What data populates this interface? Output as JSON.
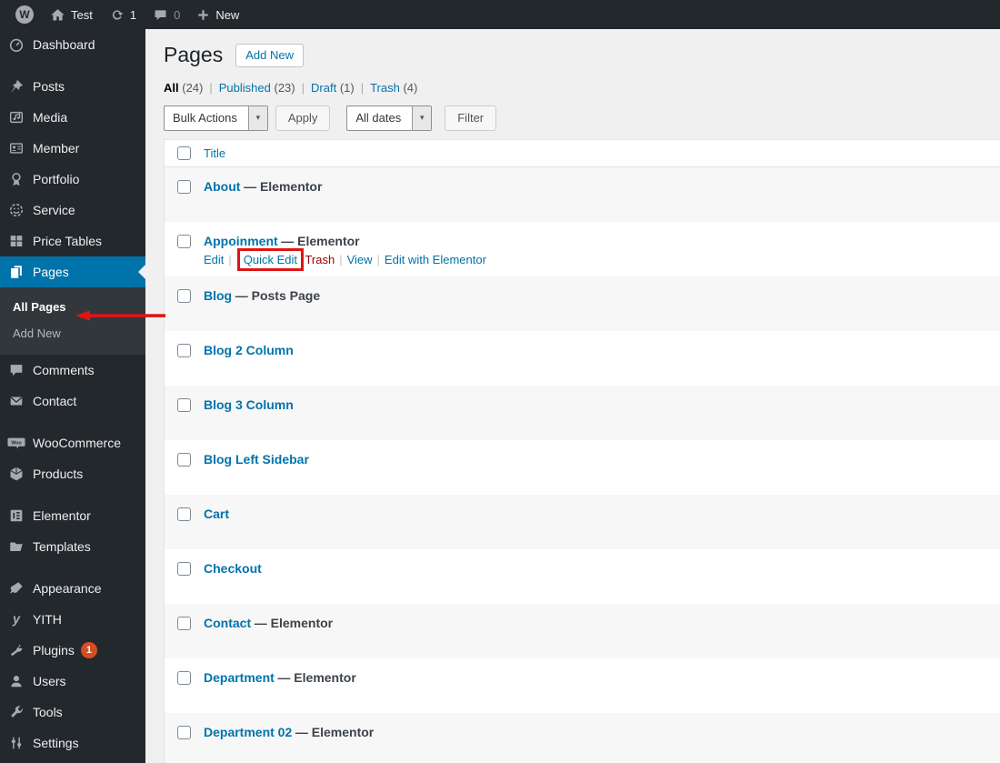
{
  "admin_bar": {
    "site_name": "Test",
    "update_count": "1",
    "comment_count": "0",
    "new_label": "New"
  },
  "icons": {
    "wp_glyph": "W",
    "woo_label": "Woo",
    "yith_glyph": "y",
    "chevron": "▾"
  },
  "sidebar": {
    "items": [
      {
        "label": "Dashboard",
        "icon": "dashboard-icon"
      },
      {
        "label": "Posts",
        "icon": "pushpin-icon"
      },
      {
        "label": "Media",
        "icon": "media-icon"
      },
      {
        "label": "Member",
        "icon": "id-card-icon"
      },
      {
        "label": "Portfolio",
        "icon": "award-icon"
      },
      {
        "label": "Service",
        "icon": "smiley-icon"
      },
      {
        "label": "Price Tables",
        "icon": "grid-icon"
      },
      {
        "label": "Pages",
        "icon": "pages-icon",
        "active": true
      },
      {
        "label": "Comments",
        "icon": "comment-icon"
      },
      {
        "label": "Contact",
        "icon": "envelope-icon"
      },
      {
        "label": "WooCommerce",
        "icon": "woocommerce-icon"
      },
      {
        "label": "Products",
        "icon": "cube-icon"
      },
      {
        "label": "Elementor",
        "icon": "elementor-icon"
      },
      {
        "label": "Templates",
        "icon": "folder-icon"
      },
      {
        "label": "Appearance",
        "icon": "brush-icon"
      },
      {
        "label": "YITH",
        "icon": "yith-icon"
      },
      {
        "label": "Plugins",
        "icon": "plug-icon",
        "badge": "1"
      },
      {
        "label": "Users",
        "icon": "user-icon"
      },
      {
        "label": "Tools",
        "icon": "wrench-icon"
      },
      {
        "label": "Settings",
        "icon": "sliders-icon"
      }
    ],
    "submenu": {
      "items": [
        {
          "label": "All Pages",
          "active": true
        },
        {
          "label": "Add New"
        }
      ]
    }
  },
  "header": {
    "title": "Pages",
    "add_new_label": "Add New"
  },
  "filters": {
    "items": [
      {
        "label": "All",
        "count": "(24)",
        "current": true
      },
      {
        "label": "Published",
        "count": "(23)"
      },
      {
        "label": "Draft",
        "count": "(1)"
      },
      {
        "label": "Trash",
        "count": "(4)"
      }
    ]
  },
  "toolbar": {
    "bulk_actions_value": "Bulk Actions",
    "apply_label": "Apply",
    "dates_value": "All dates",
    "filter_label": "Filter"
  },
  "table": {
    "columns": {
      "title_label": "Title"
    },
    "rows": [
      {
        "title": "About",
        "suffix": "— Elementor"
      },
      {
        "title": "Appoinment",
        "suffix": "— Elementor",
        "has_actions": true
      },
      {
        "title": "Blog",
        "suffix": "— Posts Page"
      },
      {
        "title": "Blog 2 Column"
      },
      {
        "title": "Blog 3 Column"
      },
      {
        "title": "Blog Left Sidebar"
      },
      {
        "title": "Cart"
      },
      {
        "title": "Checkout"
      },
      {
        "title": "Contact",
        "suffix": "— Elementor"
      },
      {
        "title": "Department",
        "suffix": "— Elementor"
      },
      {
        "title": "Department 02",
        "suffix": "— Elementor"
      }
    ],
    "row_actions": [
      {
        "label": "Edit"
      },
      {
        "label": "Quick Edit",
        "highlighted": true
      },
      {
        "label": "Trash",
        "style": "trash"
      },
      {
        "label": "View"
      },
      {
        "label": "Edit with Elementor"
      }
    ]
  },
  "annotations": {
    "color": "#e01414",
    "box_around": "Quick Edit",
    "arrow_points_to": "All Pages"
  },
  "colors": {
    "admin_bar_bg": "#23282d",
    "sidebar_bg": "#23282d",
    "submenu_bg": "#32373c",
    "active_blue": "#0073aa",
    "link_blue": "#0073aa",
    "content_bg": "#f0f0f1",
    "row_stripe": "#f7f7f7",
    "trash_red": "#a00000",
    "plugin_badge": "#d54e21"
  }
}
